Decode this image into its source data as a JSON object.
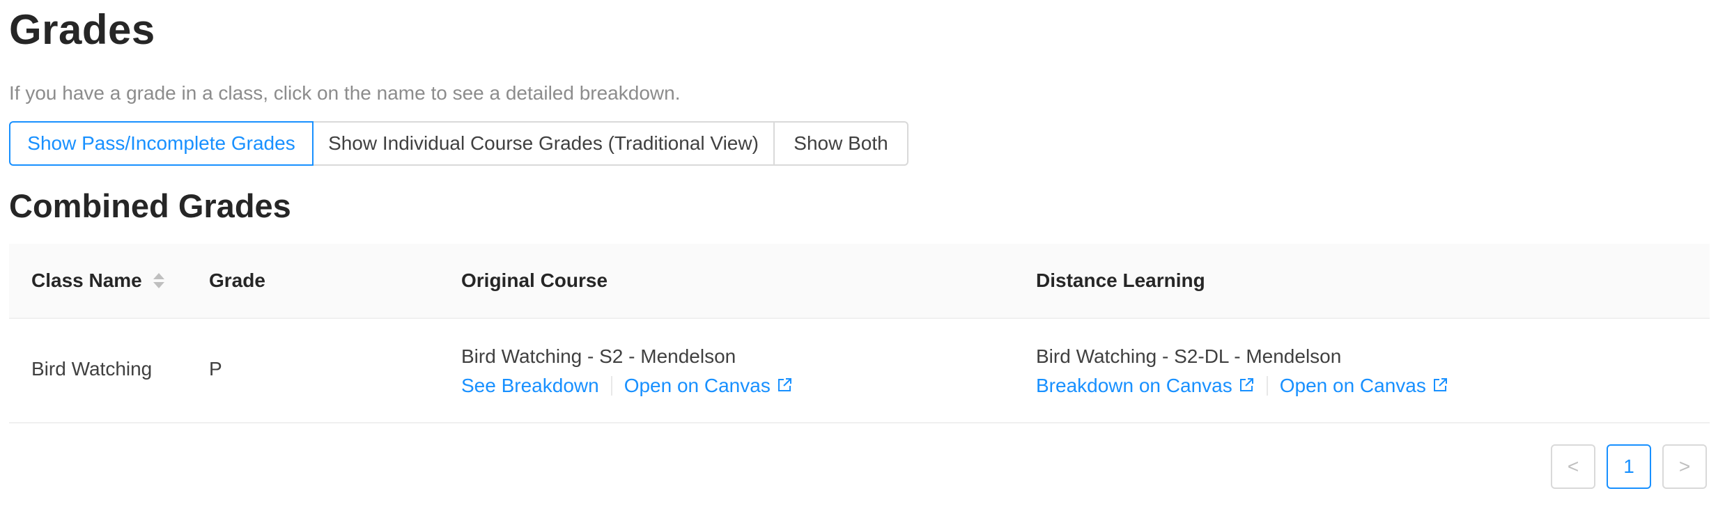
{
  "page": {
    "title": "Grades",
    "subtitle": "If you have a grade in a class, click on the name to see a detailed breakdown.",
    "view_toggle": [
      {
        "label": "Show Pass/Incomplete Grades",
        "active": true
      },
      {
        "label": "Show Individual Course Grades (Traditional View)",
        "active": false
      },
      {
        "label": "Show Both",
        "active": false
      }
    ],
    "section_title": "Combined Grades"
  },
  "table": {
    "columns": [
      "Class Name",
      "Grade",
      "Original Course",
      "Distance Learning"
    ],
    "rows": [
      {
        "class_name": "Bird Watching",
        "grade": "P",
        "original_course": {
          "name": "Bird Watching - S2 - Mendelson",
          "links": [
            "See Breakdown",
            "Open on Canvas"
          ]
        },
        "distance_learning": {
          "name": "Bird Watching - S2-DL - Mendelson",
          "links": [
            "Breakdown on Canvas",
            "Open on Canvas"
          ]
        }
      }
    ]
  },
  "pagination": {
    "prev": "<",
    "current": "1",
    "next": ">"
  },
  "colors": {
    "accent": "#1890ff",
    "text": "#262626",
    "muted": "#8c8c8c",
    "border": "#d9d9d9",
    "header_bg": "#fafafa"
  }
}
